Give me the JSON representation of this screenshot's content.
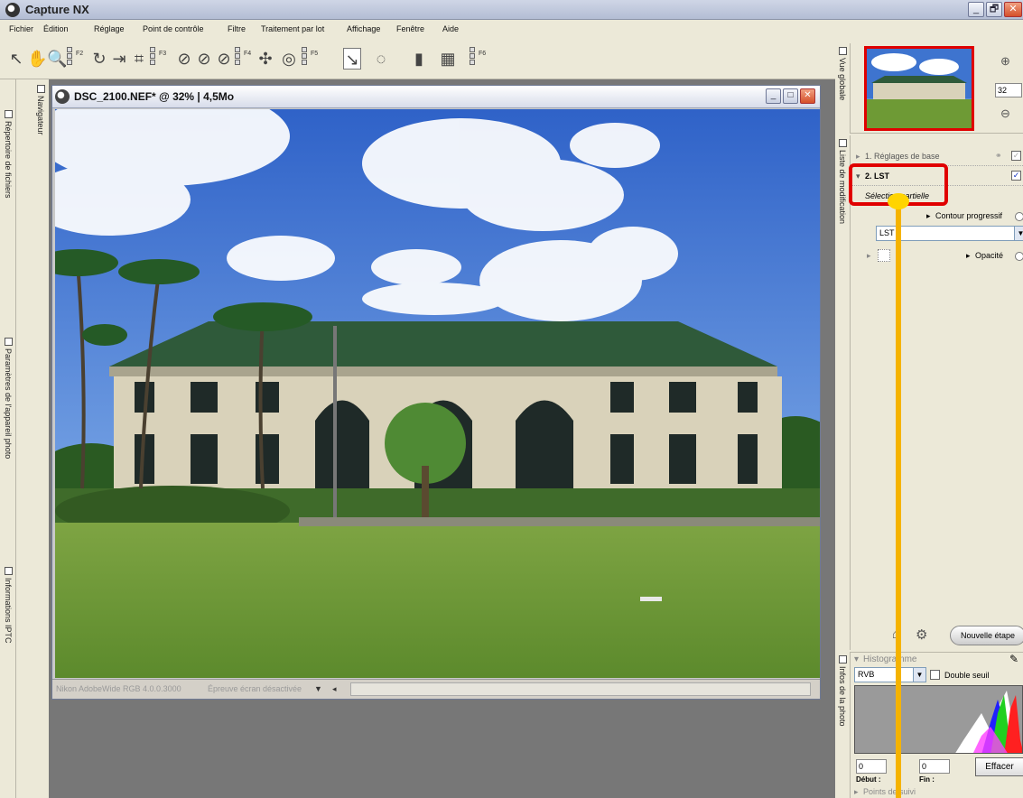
{
  "app": {
    "title": "Capture NX",
    "window_buttons": [
      "_",
      "🗗",
      "✕"
    ]
  },
  "menu": [
    "Fichier",
    "Édition",
    "Réglage",
    "Point de contrôle",
    "Filtre",
    "Traitement par lot",
    "Affichage",
    "Fenêtre",
    "Aide"
  ],
  "toolbar": {
    "groups": [
      "F2",
      "F3",
      "F4",
      "F5",
      "F6"
    ]
  },
  "left_dock": {
    "navigator": "Navigateur",
    "file_browser": "Répertoire de fichiers",
    "camera_settings": "Paramètres de l'appareil photo",
    "iptc": "Informations IPTC"
  },
  "image_window": {
    "title": "DSC_2100.NEF* @ 32% | 4,5Mo",
    "profile": "Nikon AdobeWide RGB 4.0.0.3000",
    "proof": "Épreuve écran désactivée"
  },
  "right_strips": {
    "global_view": "Vue globale",
    "edit_list": "Liste de modification",
    "photo_info": "Infos de la photo"
  },
  "zoom": {
    "value": "32"
  },
  "edit_list": {
    "step1": "1. Réglages de base",
    "step2": "2. LST",
    "partial": "Sélection partielle",
    "feather": "Contour progressif",
    "layer_select": "LST",
    "opacity": "Opacité",
    "new_step": "Nouvelle étape"
  },
  "histogram": {
    "title": "Histogramme",
    "channel": "RVB",
    "double_threshold": "Double seuil",
    "start_value": "0",
    "end_value": "0",
    "start_label": "Début :",
    "end_label": "Fin :",
    "clear": "Effacer",
    "tracking": "Points de suivi"
  },
  "colors": {
    "highlight": "#e00000",
    "arrow": "#f5b300",
    "sky": "#3d73d0",
    "grass": "#6e9a35"
  }
}
